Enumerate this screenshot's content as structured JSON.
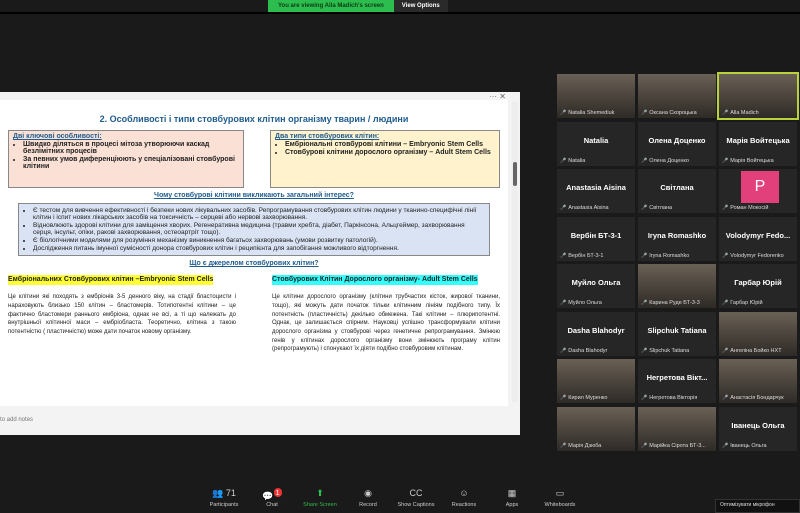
{
  "banner": {
    "viewing": "You are viewing Alla Madich's screen",
    "view_options": "View Options"
  },
  "slide": {
    "title": "2. Особливості і типи стовбурових клітин організму тварин / людини",
    "box1": {
      "heading": "Дві ключові особливості:",
      "items": [
        "Швидко діляться в процесі мітоза утворюючи каскад безлімітних процесів",
        "За певних умов диференціюють у спеціалізовані стовбурові клітини"
      ]
    },
    "box2": {
      "heading": "Два типи стовбурових клітин:",
      "items": [
        "Ембріональні стовбурові клітини – Embryonic Stem Cells",
        "Стовбурові клітини дорослого організму – Adult Stem Cells"
      ]
    },
    "q1": "Чому стовбурові клітини викликають загальний інтерес?",
    "interest": [
      "Є тестом для вивчення ефективності і безпеки нових лікувальних засобів. Репрограмування стовбурових клітин людини у тканино-специфічні лінії клітин і іспит нових лікарських засобів на токсичність – серцеві або нервові захворювання.",
      "Відновлюють здорові клітини для заміщення хворих. Регенеративна медицина (травми хребта, діабет, Паркінсона, Альцгеймер, захворювання серця, інсульт, опіки, ракові захворювання, остеоартріт тощо).",
      "Є біологічними моделями для розуміння механізму виникнення багатьох захворювань (умови розвитку патологій).",
      "Дослідження питань імунної сумісності донора стовбурових клітин і реципієнта для запобігання можливого відторгнення."
    ],
    "q2": "Що є джерелом стовбурових клітин?",
    "col1": {
      "heading": "Ембріональних Стовбурових клітин –Embryonic Stem Cells",
      "text": "Це клітини які походять з ембріонів 3-5 денного віку, на стадії бластоцисти і нараховують близько 150 клітин – бластомерів. Тотипотентні клітини – це фактично бластомери раннього ембріона, однак не всі, а ті що належать до внутрішньої клітинної маси – ембріобласта. Теоретично, клітина з такою потентністю ( пластичністю) може дати початок новому організму."
    },
    "col2": {
      "heading": "Стовбурових Клітин Дорослого організму- Adult Stem Cells",
      "text": "Це клітини дорослого організму (клітини трубчастих кісток, жирової тканини, тощо), які можуть дати початок тільки клітинним лініям подібного типу. Їх потентність (пластичність) декілько обмежена. Такі клітини – плюрипотентні. Однак, це залишається спірним. Науковці успішно трансформували клітини дорослого організма у стовбурові через генетичне репрограмування. Змінюю генів у клітинах дорослого організму вони змінюють програму клітин (репрограмують) і спонукают їх діяти подібно стовбуровим клітинам."
    },
    "notes": "to add notes"
  },
  "participants": [
    {
      "name": "",
      "label": "Natalia Shemediuk",
      "video": true
    },
    {
      "name": "",
      "label": "Оксана Скороцька",
      "video": true
    },
    {
      "name": "",
      "label": "Alla Madich",
      "video": true,
      "active": true
    },
    {
      "name": "Natalia",
      "label": "Natalia"
    },
    {
      "name": "Олена Доценко",
      "label": "Олена Доценко"
    },
    {
      "name": "Марія Войтецька",
      "label": "Марія Войтецька"
    },
    {
      "name": "Anastasia Aisina",
      "label": "Anastasia Aisina"
    },
    {
      "name": "Світлана",
      "label": "Світлана"
    },
    {
      "name": "",
      "label": "Роман Мокосій",
      "avatar": "P"
    },
    {
      "name": "Вербін БТ-3-1",
      "label": "Вербін БТ-3-1"
    },
    {
      "name": "Iryna Romashko",
      "label": "Iryna Romashko"
    },
    {
      "name": "Volodymyr Fedo...",
      "label": "Volodymyr Fedorenko"
    },
    {
      "name": "Муйло Ольга",
      "label": "Муйло Ольга"
    },
    {
      "name": "",
      "label": "Карина Руде БТ-3-3",
      "video": true
    },
    {
      "name": "Гарбар Юрій",
      "label": "Гарбар Юрій"
    },
    {
      "name": "Dasha Blahodyr",
      "label": "Dasha Blahodyr"
    },
    {
      "name": "Slipchuk Tatiana",
      "label": "Slipchuk Tatiana"
    },
    {
      "name": "",
      "label": "Ангеліна Бойко НХТ",
      "video": true
    },
    {
      "name": "",
      "label": "Кирил Муренко",
      "video": true
    },
    {
      "name": "Негретова Вікт...",
      "label": "Негретова Вікторія"
    },
    {
      "name": "",
      "label": "Анастасія Бондарчук",
      "video": true
    },
    {
      "name": "",
      "label": "Марія Дзюба",
      "video": true
    },
    {
      "name": "",
      "label": "Марійка Сірота БТ-3...",
      "video": true
    },
    {
      "name": "Іванець Ольга",
      "label": "Іванець Ольга"
    }
  ],
  "toolbar": [
    {
      "label": "Participants",
      "icon": "👥",
      "count": "71"
    },
    {
      "label": "Chat",
      "icon": "💬",
      "badge": "1"
    },
    {
      "label": "Share Screen",
      "icon": "⬆"
    },
    {
      "label": "Record",
      "icon": "◉"
    },
    {
      "label": "Show Captions",
      "icon": "CC"
    },
    {
      "label": "Reactions",
      "icon": "☺"
    },
    {
      "label": "Apps",
      "icon": "▦"
    },
    {
      "label": "Whiteboards",
      "icon": "▭"
    }
  ],
  "popup": "Оптимізувати мікрофон"
}
